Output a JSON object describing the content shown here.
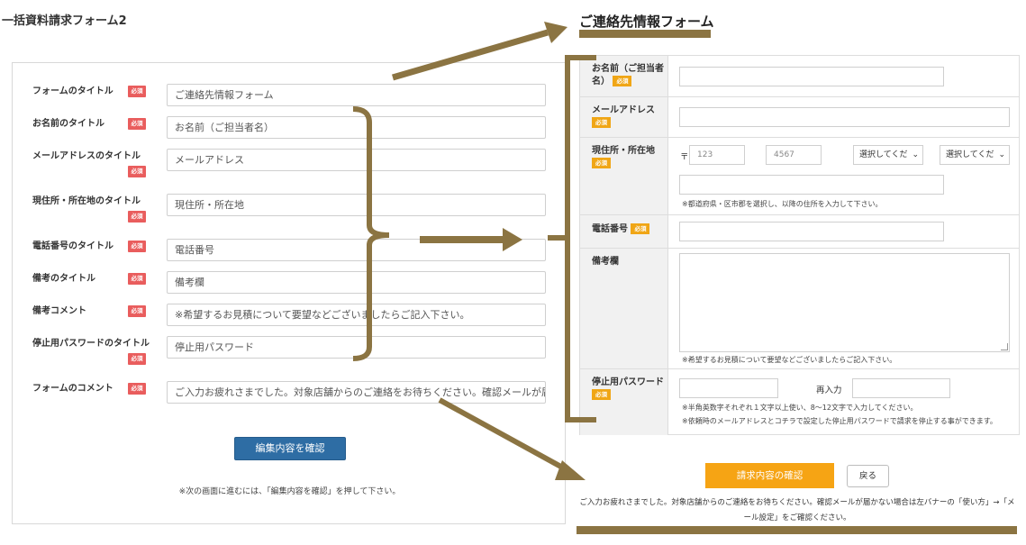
{
  "page_title": "一括資料請求フォーム2",
  "required_badge": "必須",
  "editor": {
    "rows": [
      {
        "label": "フォームのタイトル",
        "value": "ご連絡先情報フォーム"
      },
      {
        "label": "お名前のタイトル",
        "value": "お名前（ご担当者名）"
      },
      {
        "label": "メールアドレスのタイトル",
        "value": "メールアドレス"
      },
      {
        "label": "現住所・所在地のタイトル",
        "value": "現住所・所在地"
      },
      {
        "label": "電話番号のタイトル",
        "value": "電話番号"
      },
      {
        "label": "備考のタイトル",
        "value": "備考欄"
      },
      {
        "label": "備考コメント",
        "value": "※希望するお見積について要望などございましたらご記入下さい。"
      },
      {
        "label": "停止用パスワードのタイトル",
        "value": "停止用パスワード"
      },
      {
        "label": "フォームのコメント",
        "value": "ご入力お疲れさまでした。対象店舗からのご連絡をお待ちください。確認メールが届か"
      }
    ],
    "confirm_button": "編集内容を確認",
    "note": "※次の画面に進むには、「編集内容を確認」を押して下さい。"
  },
  "preview": {
    "title": "ご連絡先情報フォーム",
    "name_label": "お名前（ご担当者名）",
    "email_label": "メールアドレス",
    "address_label": "現住所・所在地",
    "postal_mark": "〒",
    "postal_placeholder_1": "123",
    "postal_placeholder_2": "4567",
    "select_placeholder": "選択してくだ",
    "address_note": "※都道府県・区市郡を選択し、以降の住所を入力して下さい。",
    "phone_label": "電話番号",
    "remarks_label": "備考欄",
    "remarks_note": "※希望するお見積について要望などございましたらご記入下さい。",
    "password_label": "停止用パスワード",
    "reenter_label": "再入力",
    "password_note_1": "※半角英数字それぞれ１文字以上使い、8〜12文字で入力してください。",
    "password_note_2": "※依頼時のメールアドレスとコチラで設定した停止用パスワードで請求を停止する事ができます。",
    "submit_button": "請求内容の確認",
    "back_button": "戻る",
    "done_message": "ご入力お疲れさまでした。対象店舗からのご連絡をお待ちください。確認メールが届かない場合は左バナーの「使い方」→「メール設定」をご確認ください。"
  },
  "colors": {
    "annotation": "#8b7442",
    "required_red": "#e95d5d",
    "required_orange": "#f0a616",
    "primary_blue": "#2e6da4",
    "submit_orange": "#f6a414"
  }
}
